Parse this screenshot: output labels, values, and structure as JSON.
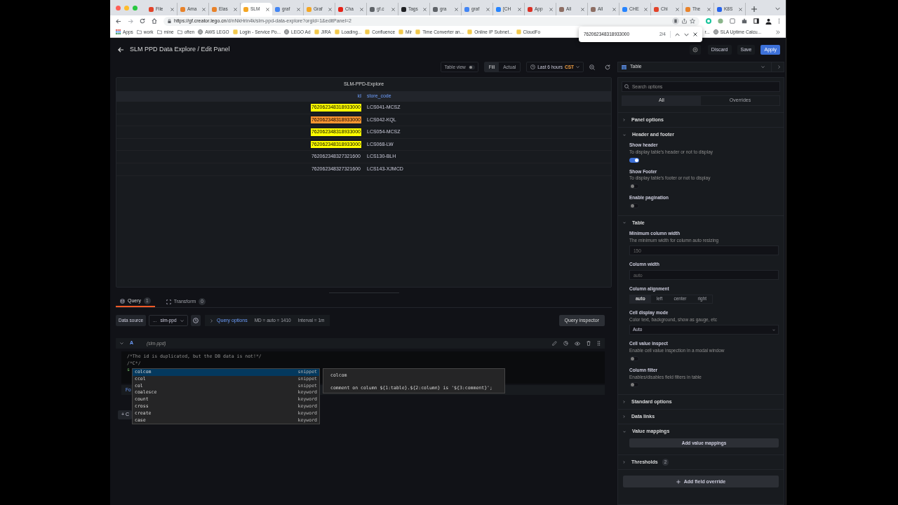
{
  "browser": {
    "tabs": [
      {
        "label": "File",
        "selected": false,
        "color": "#e24329"
      },
      {
        "label": "Ama",
        "selected": false,
        "color": "#e8822a"
      },
      {
        "label": "Elas",
        "selected": false,
        "color": "#e8822a"
      },
      {
        "label": "SLM",
        "selected": true,
        "color": "#f4a623"
      },
      {
        "label": "graf",
        "selected": false,
        "color": "#4285f4"
      },
      {
        "label": "Graf",
        "selected": false,
        "color": "#f4a623"
      },
      {
        "label": "Cha",
        "selected": false,
        "color": "#e62117"
      },
      {
        "label": "gf.c",
        "selected": false,
        "color": "#5f6368"
      },
      {
        "label": "Tags",
        "selected": false,
        "color": "#202124"
      },
      {
        "label": "gra",
        "selected": false,
        "color": "#5f6368"
      },
      {
        "label": "graf",
        "selected": false,
        "color": "#4285f4"
      },
      {
        "label": "[CH",
        "selected": false,
        "color": "#2684ff"
      },
      {
        "label": "App",
        "selected": false,
        "color": "#d93025"
      },
      {
        "label": "All",
        "selected": false,
        "color": "#8d6e63"
      },
      {
        "label": "All",
        "selected": false,
        "color": "#8d6e63"
      },
      {
        "label": "CHE",
        "selected": false,
        "color": "#2684ff"
      },
      {
        "label": "Chi",
        "selected": false,
        "color": "#e24329"
      },
      {
        "label": "The",
        "selected": false,
        "color": "#e8822a"
      },
      {
        "label": "K8S",
        "selected": false,
        "color": "#2563eb"
      }
    ],
    "url_host": "https://gf.creator.lego.cn",
    "url_path": "/d/nNkHrin4k/slm-ppd-data-explore?orgId=1&editPanel=2",
    "bookmarks": [
      {
        "label": "Apps",
        "kind": "apps"
      },
      {
        "label": "work",
        "kind": "folder"
      },
      {
        "label": "mine",
        "kind": "folder"
      },
      {
        "label": "often",
        "kind": "folder"
      },
      {
        "label": "AWS LEGO",
        "kind": "globe"
      },
      {
        "label": "Login - Service Po...",
        "kind": "site"
      },
      {
        "label": "LEGO Ad",
        "kind": "globe"
      },
      {
        "label": "JIRA",
        "kind": "site"
      },
      {
        "label": "Loading...",
        "kind": "site"
      },
      {
        "label": "Confluence",
        "kind": "site"
      },
      {
        "label": "Mir",
        "kind": "site"
      },
      {
        "label": "Time Converter an...",
        "kind": "site"
      },
      {
        "label": "Online IP Subnet...",
        "kind": "site"
      },
      {
        "label": "CloudFo",
        "kind": "site"
      },
      {
        "label": "r...",
        "kind": "plain"
      },
      {
        "label": "SLA Uptime Calcu...",
        "kind": "globe"
      }
    ],
    "find_bar": {
      "query": "762062348318933000",
      "count": "2/4"
    }
  },
  "header": {
    "title": "SLM PPD Data Explore / Edit Panel",
    "buttons": [
      {
        "label": "Discard",
        "kind": "secondary"
      },
      {
        "label": "Save",
        "kind": "secondary"
      },
      {
        "label": "Apply",
        "kind": "primary"
      }
    ]
  },
  "toolbar": {
    "table_view": {
      "label": "Table view",
      "on": false
    },
    "size_modes": [
      {
        "label": "Fill",
        "selected": true
      },
      {
        "label": "Actual",
        "selected": false
      }
    ],
    "time_range": "Last 6 hours",
    "timezone": "CST",
    "visualization": "Table"
  },
  "panel": {
    "title": "SLM-PPD-Explore",
    "columns": [
      "id",
      "store_code"
    ],
    "rows": [
      {
        "id": "762062348318933000",
        "store_code": "LCS041-MCSZ",
        "highlighted": true,
        "current_match": false
      },
      {
        "id": "762062348318933000",
        "store_code": "LCS042-KQL",
        "highlighted": true,
        "current_match": true
      },
      {
        "id": "762062348318933000",
        "store_code": "LCS054-MCSZ",
        "highlighted": true,
        "current_match": false
      },
      {
        "id": "762062348318933000",
        "store_code": "LCS068-LW",
        "highlighted": true,
        "current_match": false
      },
      {
        "id": "762062348327321600",
        "store_code": "LCS130-BLH",
        "highlighted": false,
        "current_match": false
      },
      {
        "id": "762062348327321600",
        "store_code": "LCS143-XJMCD",
        "highlighted": false,
        "current_match": false
      }
    ]
  },
  "query_tabs": [
    {
      "label": "Query",
      "count": "1",
      "selected": true
    },
    {
      "label": "Transform",
      "count": "0",
      "selected": false
    }
  ],
  "data_source": {
    "label": "Data source",
    "prefix": "...",
    "value": "slm-ppd",
    "query_options": "Query options",
    "info": [
      "MD = auto = 1410",
      "Interval = 1m"
    ],
    "inspector": "Query inspector"
  },
  "query": {
    "ref": "A",
    "source": "(slm-ppd)",
    "lines": [
      "/*The id is duplicated, but the DB data is not!*/",
      "/*C*/"
    ],
    "hidden_line": "s",
    "format_fragment": "Fo",
    "add_fragment": "+ C"
  },
  "autocomplete": {
    "items": [
      {
        "label": "colcom",
        "type": "snippet",
        "selected": true
      },
      {
        "label": "ccol",
        "type": "snippet",
        "selected": false
      },
      {
        "label": "col",
        "type": "snippet",
        "selected": false
      },
      {
        "label": "coalesce",
        "type": "keyword",
        "selected": false
      },
      {
        "label": "count",
        "type": "keyword",
        "selected": false
      },
      {
        "label": "cross",
        "type": "keyword",
        "selected": false
      },
      {
        "label": "create",
        "type": "keyword",
        "selected": false
      },
      {
        "label": "case",
        "type": "keyword",
        "selected": false
      }
    ],
    "detail": {
      "title": "colcom",
      "body": "comment on column ${1:table}.${2:column} is '${3:comment}';"
    }
  },
  "options": {
    "search_placeholder": "Search options",
    "tabs": [
      {
        "label": "All",
        "selected": true
      },
      {
        "label": "Overrides",
        "selected": false
      }
    ],
    "sections": [
      {
        "title": "Panel options",
        "expanded": false
      },
      {
        "title": "Header and footer",
        "expanded": true,
        "items": [
          {
            "kind": "toggle",
            "label": "Show header",
            "description": "To display table's header or not to display",
            "on": true
          },
          {
            "kind": "toggle",
            "label": "Show Footer",
            "description": "To display table's footer or not to display",
            "on": false
          },
          {
            "kind": "toggle",
            "label": "Enable pagination",
            "on": false
          }
        ]
      },
      {
        "title": "Table",
        "expanded": true,
        "items": [
          {
            "kind": "input",
            "label": "Minimum column width",
            "description": "The minimum width for column auto resizing",
            "placeholder": "150"
          },
          {
            "kind": "input",
            "label": "Column width",
            "placeholder": "auto"
          },
          {
            "kind": "radio",
            "label": "Column alignment",
            "options": [
              {
                "label": "auto",
                "selected": true
              },
              {
                "label": "left",
                "selected": false
              },
              {
                "label": "center",
                "selected": false
              },
              {
                "label": "right",
                "selected": false
              }
            ]
          },
          {
            "kind": "select",
            "label": "Cell display mode",
            "description": "Color text, background, show as gauge, etc",
            "value": "Auto"
          },
          {
            "kind": "toggle",
            "label": "Cell value inspect",
            "description": "Enable cell value inspection in a modal window",
            "on": false
          },
          {
            "kind": "toggle",
            "label": "Column filter",
            "description": "Enables/disables field filters in table",
            "on": false
          }
        ]
      },
      {
        "title": "Standard options",
        "expanded": false
      },
      {
        "title": "Data links",
        "expanded": false
      },
      {
        "title": "Value mappings",
        "expanded": true,
        "items": [
          {
            "kind": "button",
            "label": "Add value mappings"
          }
        ]
      },
      {
        "title": "Thresholds",
        "expanded": false,
        "badge": "2"
      }
    ],
    "add_override": "Add field override"
  }
}
